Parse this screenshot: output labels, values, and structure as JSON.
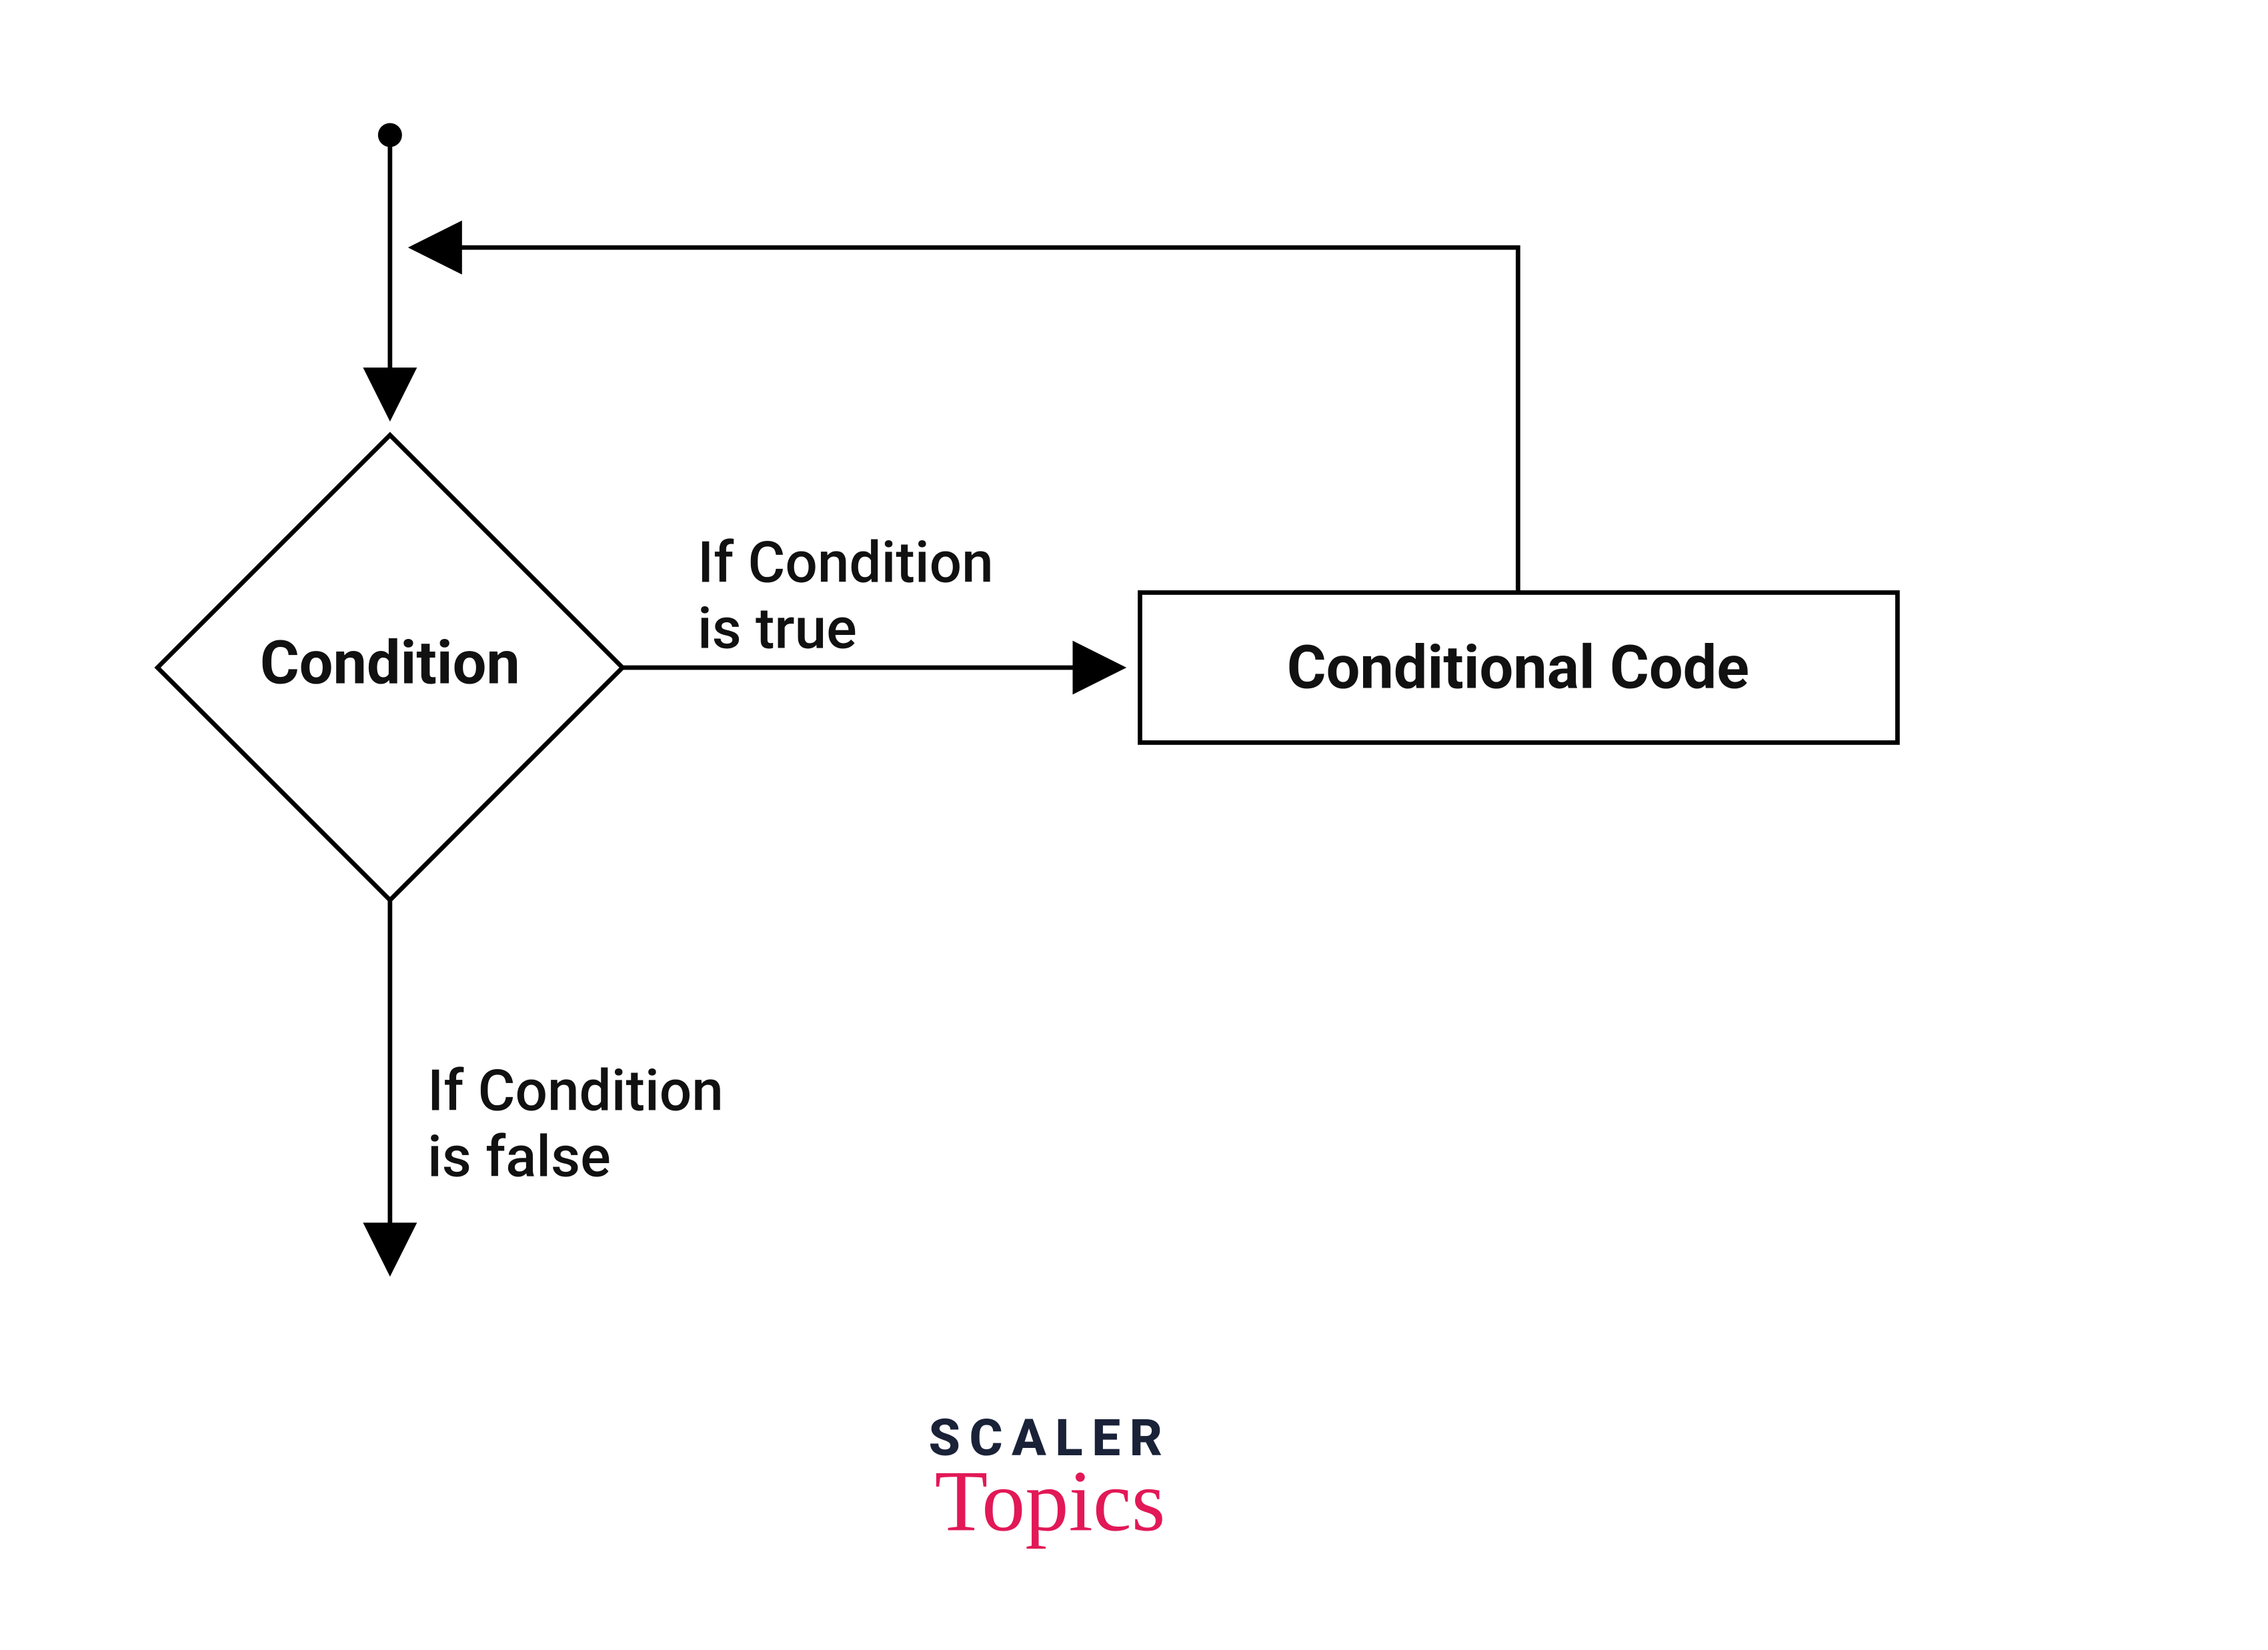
{
  "diagram": {
    "condition_label": "Condition",
    "code_label": "Conditional Code",
    "true_label_line1": "If Condition",
    "true_label_line2": "is true",
    "false_label_line1": "If Condition",
    "false_label_line2": "is false"
  },
  "branding": {
    "scaler": "SCALER",
    "topics": "Topics"
  }
}
